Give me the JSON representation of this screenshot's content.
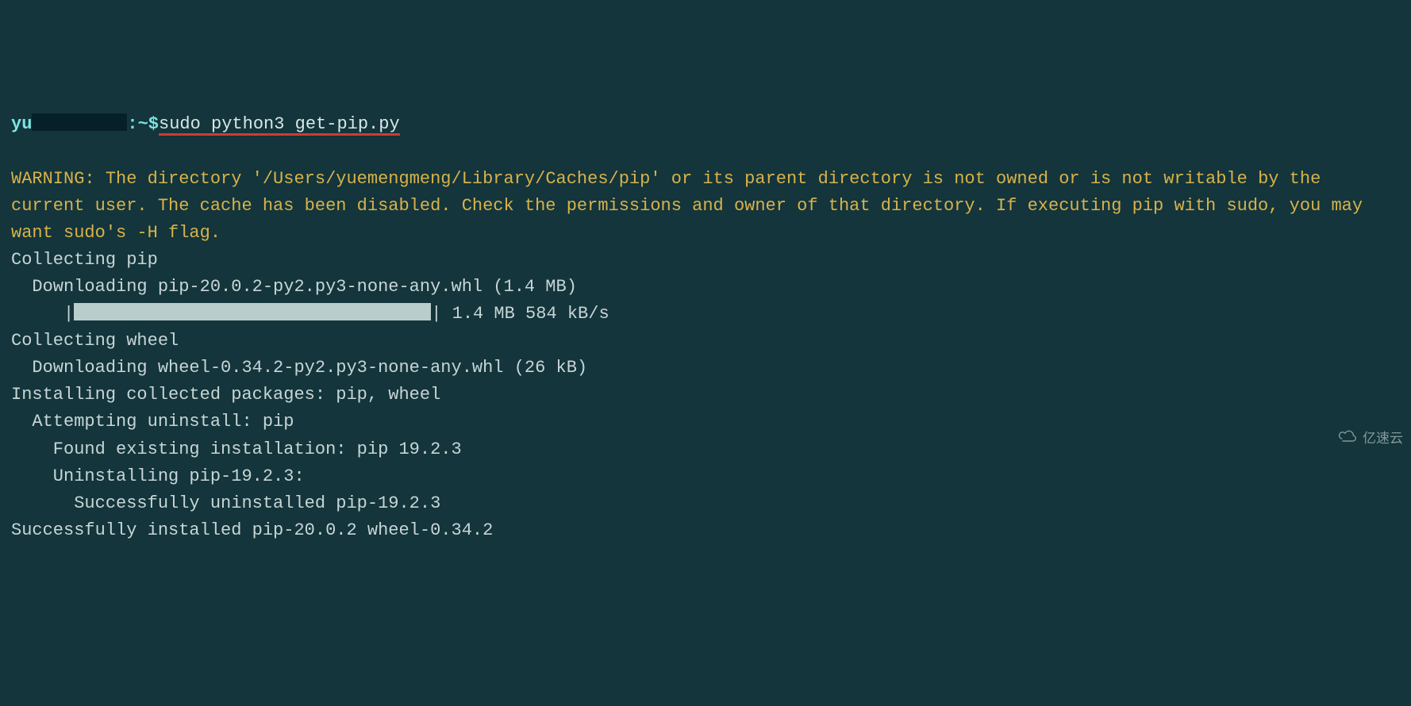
{
  "prompt": {
    "user_prefix": "yu",
    "path": ":~$",
    "command": "sudo python3 get-pip.py"
  },
  "warning_label": "WARNING:",
  "warning_text": " The directory '/Users/yuemengmeng/Library/Caches/pip' or its parent directory is not owned or is not writable by the current user. The cache has been disabled. Check the permissions and owner of that directory. If executing pip with sudo, you may want sudo's -H flag.",
  "lines": {
    "collect_pip": "Collecting pip",
    "download_pip": "  Downloading pip-20.0.2-py2.py3-none-any.whl (1.4 MB)",
    "progress_prefix": "     |",
    "progress_suffix": "| 1.4 MB 584 kB/s",
    "collect_wheel": "Collecting wheel",
    "download_wheel": "  Downloading wheel-0.34.2-py2.py3-none-any.whl (26 kB)",
    "installing": "Installing collected packages: pip, wheel",
    "attempt_uninstall": "  Attempting uninstall: pip",
    "found_existing": "    Found existing installation: pip 19.2.3",
    "uninstalling": "    Uninstalling pip-19.2.3:",
    "uninstalled_ok": "      Successfully uninstalled pip-19.2.3",
    "installed_ok": "Successfully installed pip-20.0.2 wheel-0.34.2"
  },
  "watermark": "亿速云"
}
